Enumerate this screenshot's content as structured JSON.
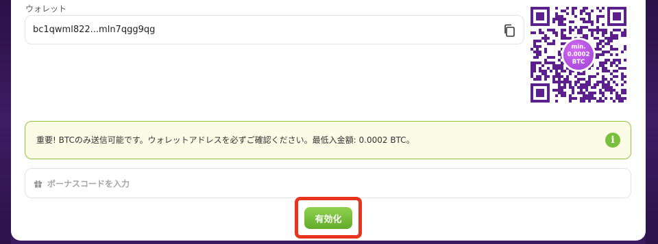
{
  "wallet": {
    "label": "ウォレット",
    "address": "bc1qwml822...mln7qgg9qg",
    "qr_badge": {
      "line1": "min.",
      "line2": "0.0002",
      "line3": "BTC"
    }
  },
  "notice": {
    "text": "重要! BTCのみ送信可能です。ウォレットアドレスを必ずご確認ください。最低入金額: 0.0002 BTC。",
    "icon": "info-icon"
  },
  "bonus": {
    "placeholder": "ボーナスコードを入力",
    "icon": "gift-icon"
  },
  "actions": {
    "activate_label": "有効化"
  },
  "colors": {
    "accent_green": "#7bbf3f",
    "notice_border": "#8cc63f",
    "qr_purple": "#5b1f8e",
    "highlight_red": "#e8341c",
    "background": "#3a1a5e"
  }
}
